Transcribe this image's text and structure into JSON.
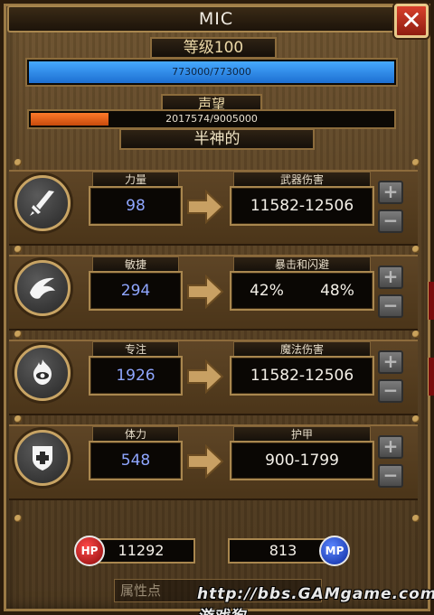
{
  "window": {
    "title": "MIC",
    "close_icon": "close-x-icon"
  },
  "level": {
    "label": "等级100",
    "xp_text": "773000/773000",
    "xp_fraction": 1.0,
    "xp_color": "#2f8ef0"
  },
  "reputation": {
    "label": "声望",
    "value_text": "2017574/9005000",
    "fraction": 0.224,
    "bar_color": "#f06a1c",
    "rank": "半神的"
  },
  "stats": [
    {
      "icon": "sword-icon",
      "label": "力量",
      "value": "98",
      "result_label": "武器伤害",
      "result": "11582-12506"
    },
    {
      "icon": "dodge-hand-icon",
      "label": "敏捷",
      "value": "294",
      "result_label": "暴击和闪避",
      "result_a": "42%",
      "result_b": "48%"
    },
    {
      "icon": "eye-flame-icon",
      "label": "专注",
      "value": "1926",
      "result_label": "魔法伤害",
      "result": "11582-12506"
    },
    {
      "icon": "shield-cross-icon",
      "label": "体力",
      "value": "548",
      "result_label": "护甲",
      "result": "900-1799"
    }
  ],
  "buttons": {
    "plus": "+",
    "minus": "−"
  },
  "vitals": {
    "hp_label": "HP",
    "hp": "11292",
    "mp": "813",
    "mp_label": "MP"
  },
  "attribute_points_label": "属性点",
  "watermark": "http://bbs.GAMgame.com 游戏狗"
}
